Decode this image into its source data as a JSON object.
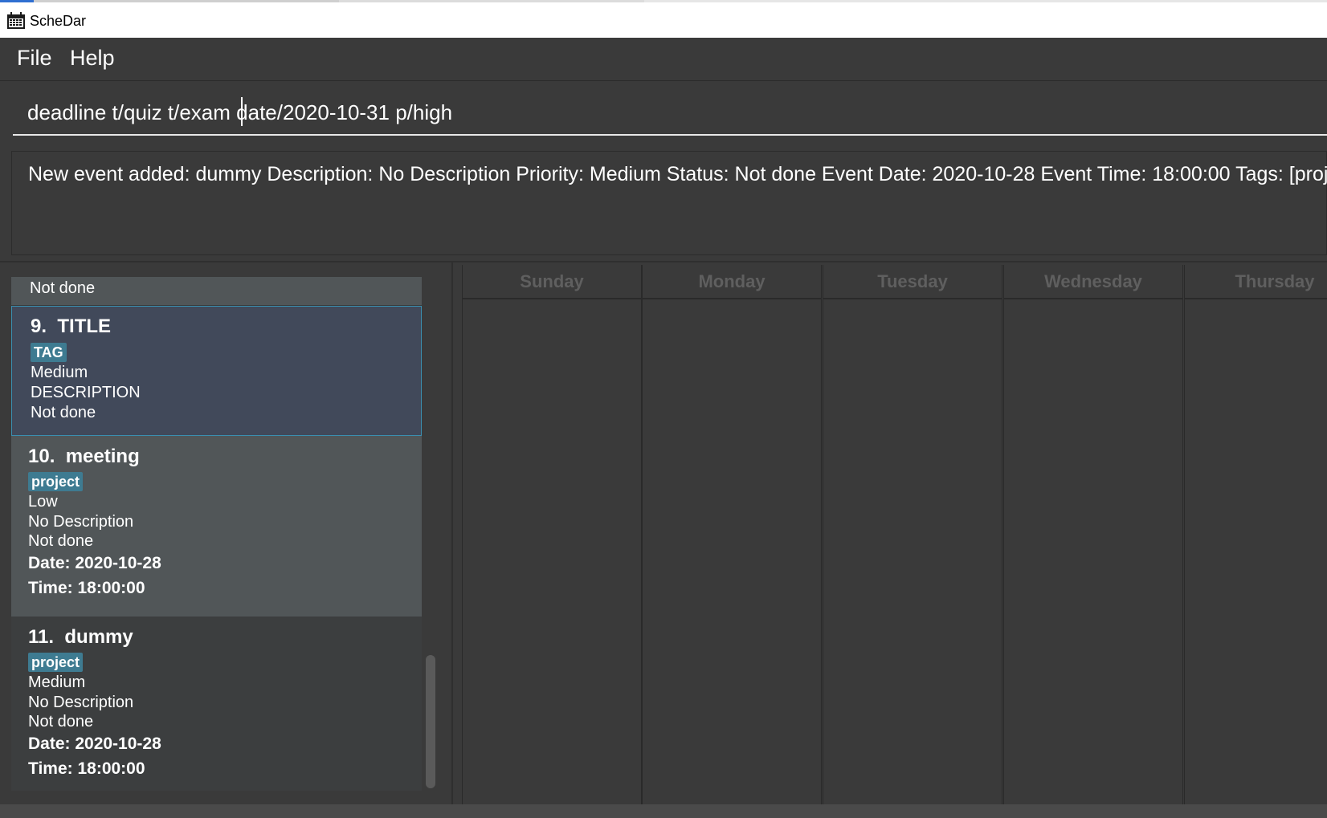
{
  "window": {
    "title": "ScheDar"
  },
  "menu": {
    "file": "File",
    "help": "Help"
  },
  "command": {
    "text": "deadline t/quiz t/exam date/2020-10-31 p/high"
  },
  "result": {
    "text": "New event added: dummy Description: No Description Priority: Medium Status: Not done Event Date: 2020-10-28 Event Time: 18:00:00 Tags: [project]"
  },
  "list": {
    "previous_status": "Not done",
    "items": [
      {
        "index": "9.",
        "title": "TITLE",
        "tag": "TAG",
        "priority": "Medium",
        "description": "DESCRIPTION",
        "status": "Not done"
      },
      {
        "index": "10.",
        "title": "meeting",
        "tag": "project",
        "priority": "Low",
        "description": "No Description",
        "status": "Not done",
        "date": "Date: 2020-10-28",
        "time": "Time: 18:00:00"
      },
      {
        "index": "11.",
        "title": "dummy",
        "tag": "project",
        "priority": "Medium",
        "description": "No Description",
        "status": "Not done",
        "date": "Date: 2020-10-28",
        "time": "Time: 18:00:00"
      }
    ]
  },
  "calendar": {
    "days": [
      "Sunday",
      "Monday",
      "Tuesday",
      "Wednesday",
      "Thursday"
    ]
  },
  "colors": {
    "tag": "#3e7b91",
    "selected_border": "#3a8fb0",
    "background": "#3a3a3a"
  }
}
